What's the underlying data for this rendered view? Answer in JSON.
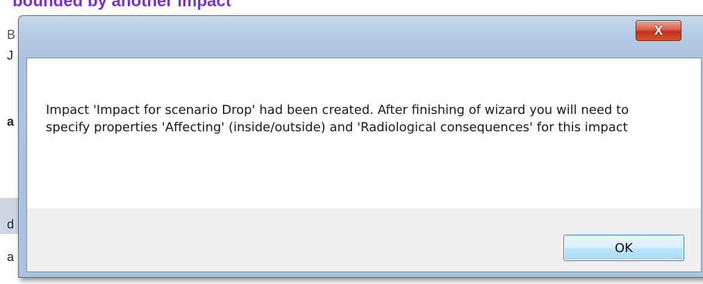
{
  "background": {
    "heading": "bounded by another impact",
    "left_fragments": [
      "B",
      "J",
      "a",
      "d",
      "a"
    ]
  },
  "dialog": {
    "close_label": "X",
    "message": "Impact 'Impact for scenario Drop' had been created. After finishing of wizard you will need to specify properties 'Affecting' (inside/outside) and 'Radiological consequences' for this impact",
    "ok_label": "OK"
  }
}
